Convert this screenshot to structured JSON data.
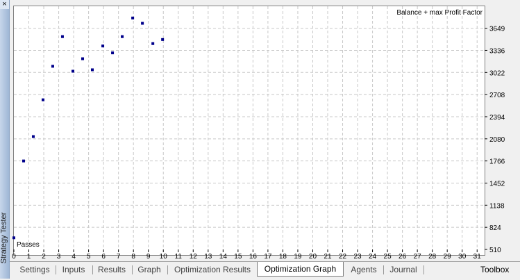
{
  "window": {
    "title": "Strategy Tester",
    "close_label": "×"
  },
  "tabs": [
    {
      "label": "Settings",
      "active": false
    },
    {
      "label": "Inputs",
      "active": false
    },
    {
      "label": "Results",
      "active": false
    },
    {
      "label": "Graph",
      "active": false
    },
    {
      "label": "Optimization Results",
      "active": false
    },
    {
      "label": "Optimization Graph",
      "active": true
    },
    {
      "label": "Agents",
      "active": false
    },
    {
      "label": "Journal",
      "active": false
    }
  ],
  "toolbox_label": "Toolbox",
  "chart_data": {
    "type": "scatter",
    "title": "Balance + max Profit Factor",
    "xlabel": "Passes",
    "ylabel": "",
    "xlim": [
      0,
      31.5
    ],
    "ylim": [
      510,
      3962
    ],
    "x_ticks": [
      0,
      1,
      2,
      3,
      4,
      5,
      6,
      7,
      8,
      9,
      10,
      11,
      12,
      13,
      14,
      15,
      16,
      17,
      18,
      19,
      20,
      21,
      22,
      23,
      24,
      25,
      26,
      27,
      28,
      29,
      30,
      31
    ],
    "y_ticks": [
      510,
      824,
      1138,
      1452,
      1766,
      2080,
      2394,
      2708,
      3022,
      3336,
      3649
    ],
    "grid": true,
    "point_color": "#00008b",
    "points": [
      {
        "x": 0,
        "y": 675
      },
      {
        "x": 0.65,
        "y": 1766
      },
      {
        "x": 1.3,
        "y": 2112
      },
      {
        "x": 1.95,
        "y": 2634
      },
      {
        "x": 2.6,
        "y": 3110
      },
      {
        "x": 3.25,
        "y": 3531
      },
      {
        "x": 3.95,
        "y": 3040
      },
      {
        "x": 4.6,
        "y": 3217
      },
      {
        "x": 5.25,
        "y": 3060
      },
      {
        "x": 5.95,
        "y": 3398
      },
      {
        "x": 6.6,
        "y": 3300
      },
      {
        "x": 7.25,
        "y": 3531
      },
      {
        "x": 7.95,
        "y": 3795
      },
      {
        "x": 8.6,
        "y": 3720
      },
      {
        "x": 9.3,
        "y": 3432
      },
      {
        "x": 9.95,
        "y": 3490
      }
    ]
  }
}
